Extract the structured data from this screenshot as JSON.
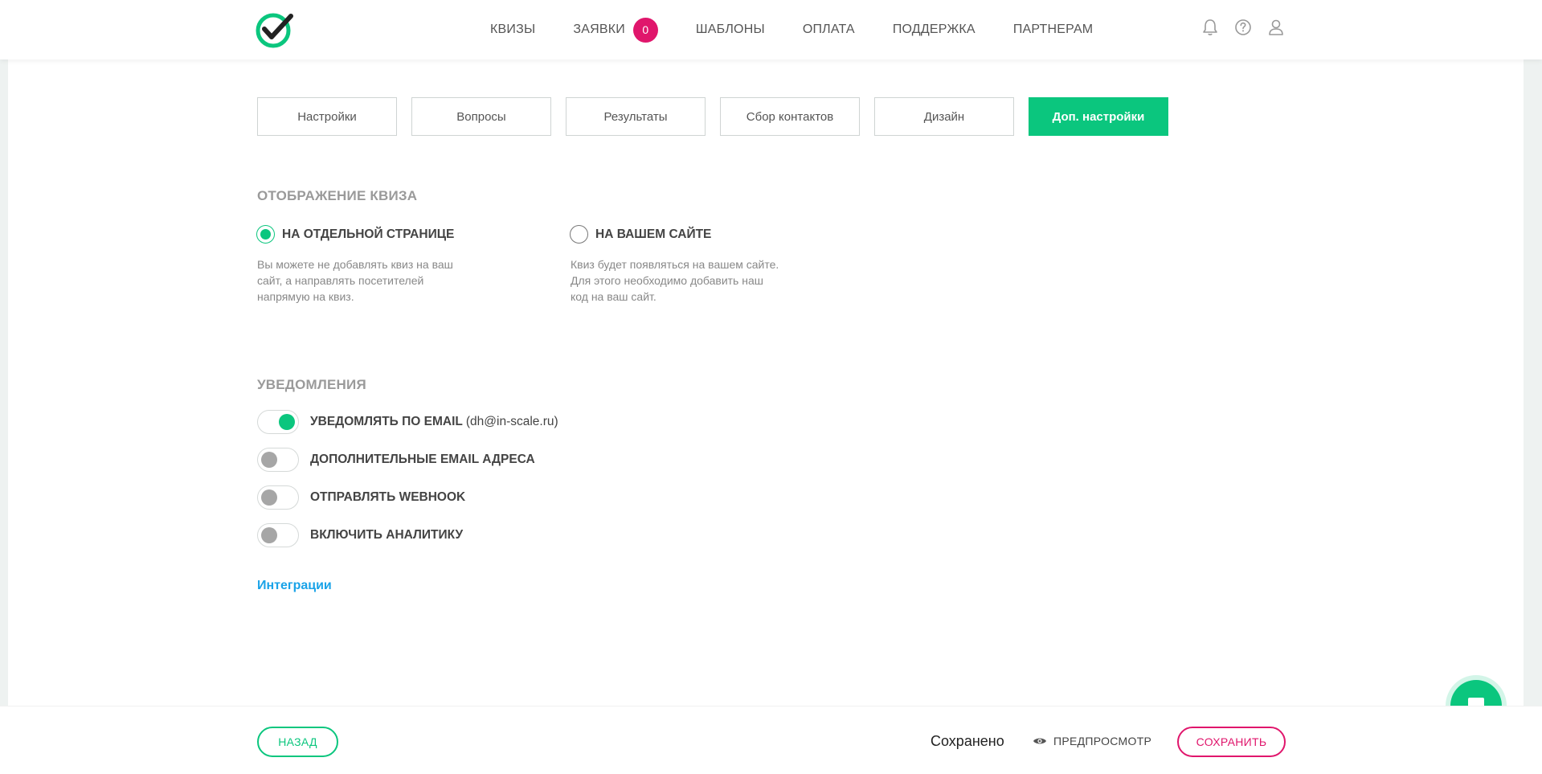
{
  "nav": {
    "items": [
      {
        "label": "КВИЗЫ"
      },
      {
        "label": "ЗАЯВКИ",
        "badge": "0"
      },
      {
        "label": "ШАБЛОНЫ"
      },
      {
        "label": "ОПЛАТА"
      },
      {
        "label": "ПОДДЕРЖКА"
      },
      {
        "label": "ПАРТНЕРАМ"
      }
    ],
    "icons": [
      "bell-icon",
      "help-icon",
      "user-icon"
    ]
  },
  "tabs": [
    {
      "label": "Настройки",
      "active": false
    },
    {
      "label": "Вопросы",
      "active": false
    },
    {
      "label": "Результаты",
      "active": false
    },
    {
      "label": "Сбор контактов",
      "active": false
    },
    {
      "label": "Дизайн",
      "active": false
    },
    {
      "label": "Доп. настройки",
      "active": true
    }
  ],
  "display": {
    "title": "ОТОБРАЖЕНИЕ КВИЗА",
    "options": [
      {
        "label": "НА ОТДЕЛЬНОЙ СТРАНИЦЕ",
        "checked": true,
        "desc": [
          "Вы можете не добавлять квиз на ваш",
          "сайт, а направлять посетителей",
          "напрямую на квиз."
        ]
      },
      {
        "label": "НА ВАШЕМ САЙТЕ",
        "checked": false,
        "desc": [
          "Квиз будет появляться на вашем сайте.",
          "Для этого необходимо добавить наш",
          "код на ваш сайт."
        ]
      }
    ]
  },
  "notifications": {
    "title": "УВЕДОМЛЕНИЯ",
    "toggles": [
      {
        "label": "УВЕДОМЛЯТЬ ПО EMAIL",
        "email": "(dh@in-scale.ru)",
        "on": true
      },
      {
        "label": "ДОПОЛНИТЕЛЬНЫЕ EMAIL АДРЕСА",
        "on": false
      },
      {
        "label": "ОТПРАВЛЯТЬ WEBHOOK",
        "on": false
      },
      {
        "label": "ВКЛЮЧИТЬ АНАЛИТИКУ",
        "on": false
      }
    ]
  },
  "integrations_link": "Интеграции",
  "footer": {
    "back_label": "НАЗАД",
    "saved_text": "Сохранено",
    "preview_label": "ПРЕДПРОСМОТР",
    "save_label": "СОХРАНИТЬ"
  },
  "colors": {
    "accent": "#0bc67e",
    "pink": "#e0166c",
    "link": "#1aa3e8"
  }
}
